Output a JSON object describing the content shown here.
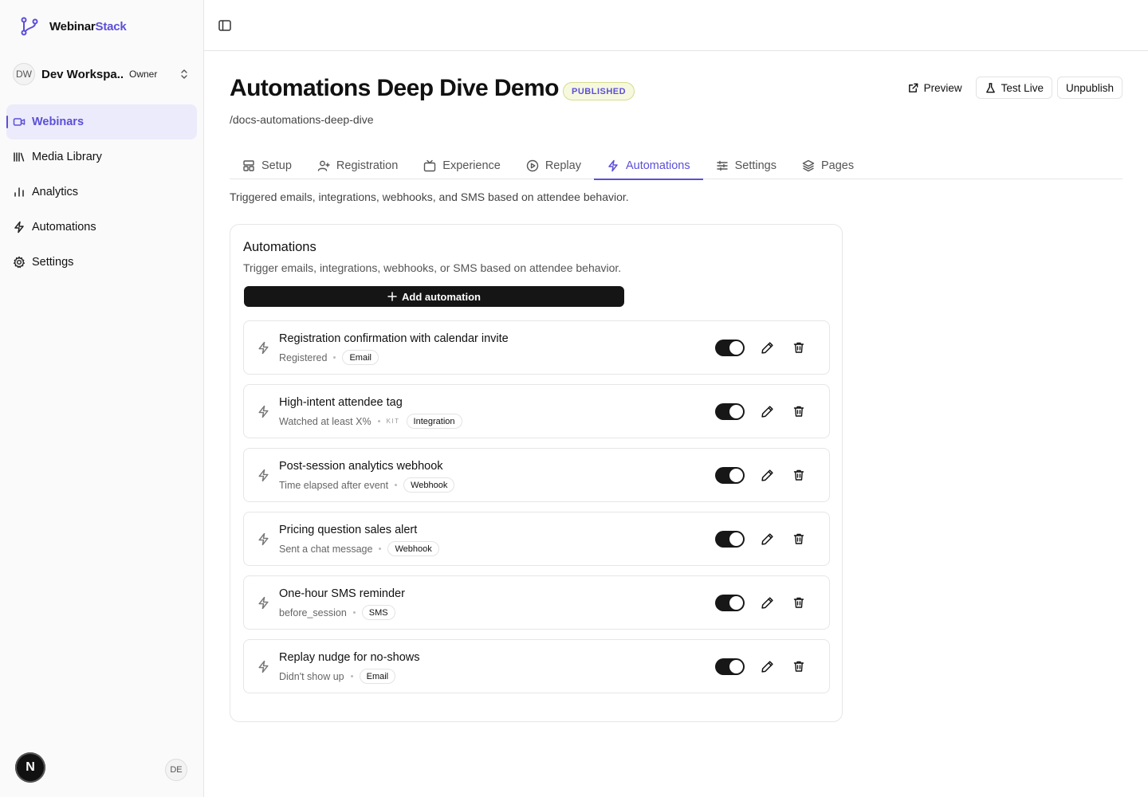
{
  "brand": {
    "name_part1": "Webinar",
    "name_part2": "Stack",
    "accent_color": "#5b4fd9"
  },
  "workspace": {
    "initials": "DW",
    "name": "Dev Workspa...",
    "role": "Owner"
  },
  "sidebar": {
    "items": [
      {
        "label": "Webinars",
        "icon": "video-icon",
        "active": true
      },
      {
        "label": "Media Library",
        "icon": "library-icon",
        "active": false
      },
      {
        "label": "Analytics",
        "icon": "bar-chart-icon",
        "active": false
      },
      {
        "label": "Automations",
        "icon": "bolt-icon",
        "active": false
      },
      {
        "label": "Settings",
        "icon": "gear-icon",
        "active": false
      }
    ],
    "bottom_badge": "N",
    "user_initials": "DE"
  },
  "header": {
    "title": "Automations Deep Dive Demo",
    "status": "PUBLISHED",
    "slug": "/docs-automations-deep-dive",
    "actions": {
      "preview": "Preview",
      "test_live": "Test Live",
      "unpublish": "Unpublish"
    }
  },
  "tabs": [
    {
      "label": "Setup",
      "icon": "setup-icon",
      "active": false
    },
    {
      "label": "Registration",
      "icon": "user-plus-icon",
      "active": false
    },
    {
      "label": "Experience",
      "icon": "tv-icon",
      "active": false
    },
    {
      "label": "Replay",
      "icon": "play-circle-icon",
      "active": false
    },
    {
      "label": "Automations",
      "icon": "bolt-icon",
      "active": true
    },
    {
      "label": "Settings",
      "icon": "sliders-icon",
      "active": false
    },
    {
      "label": "Pages",
      "icon": "layers-icon",
      "active": false
    }
  ],
  "tab_description": "Triggered emails, integrations, webhooks, and SMS based on attendee behavior.",
  "card": {
    "title": "Automations",
    "description": "Trigger emails, integrations, webhooks, or SMS based on attendee behavior.",
    "add_label": "Add automation"
  },
  "automations": [
    {
      "name": "Registration confirmation with calendar invite",
      "trigger": "Registered",
      "provider": "",
      "channel": "Email",
      "enabled": true
    },
    {
      "name": "High-intent attendee tag",
      "trigger": "Watched at least X%",
      "provider": "KIT",
      "channel": "Integration",
      "enabled": true
    },
    {
      "name": "Post-session analytics webhook",
      "trigger": "Time elapsed after event",
      "provider": "",
      "channel": "Webhook",
      "enabled": true
    },
    {
      "name": "Pricing question sales alert",
      "trigger": "Sent a chat message",
      "provider": "",
      "channel": "Webhook",
      "enabled": true
    },
    {
      "name": "One-hour SMS reminder",
      "trigger": "before_session",
      "provider": "",
      "channel": "SMS",
      "enabled": true
    },
    {
      "name": "Replay nudge for no-shows",
      "trigger": "Didn't show up",
      "provider": "",
      "channel": "Email",
      "enabled": true
    }
  ]
}
